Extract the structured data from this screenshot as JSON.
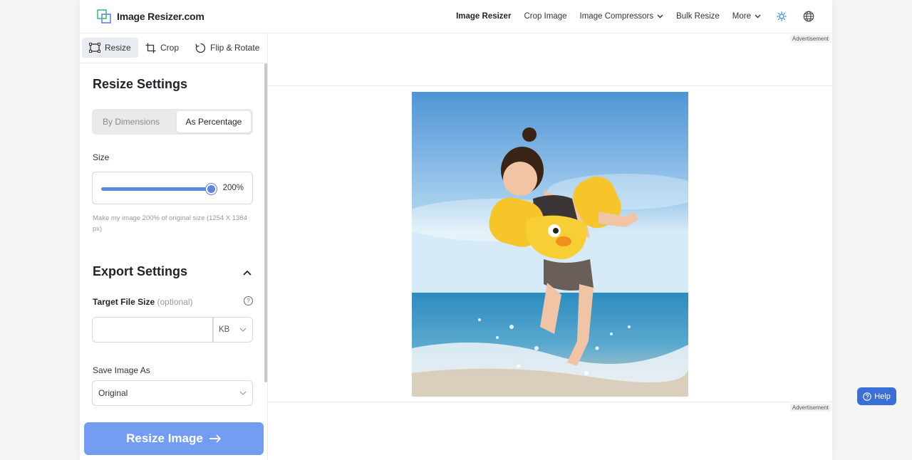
{
  "header": {
    "logo_text": "Image Resizer.com",
    "nav": [
      {
        "label": "Image Resizer"
      },
      {
        "label": "Crop Image"
      },
      {
        "label": "Image Compressors"
      },
      {
        "label": "Bulk Resize"
      },
      {
        "label": "More"
      }
    ]
  },
  "sidebar": {
    "tools": [
      {
        "label": "Resize",
        "icon": "resize-icon"
      },
      {
        "label": "Crop",
        "icon": "crop-icon"
      },
      {
        "label": "Flip & Rotate",
        "icon": "rotate-icon"
      }
    ],
    "resize_settings": {
      "title": "Resize Settings",
      "modes": [
        "By Dimensions",
        "As Percentage"
      ],
      "active_mode": "As Percentage",
      "size_label": "Size",
      "size_percent": 200,
      "size_value_text": "200%",
      "hint": "Make my image 200% of original size (1254 X 1384 px)"
    },
    "export_settings": {
      "title": "Export Settings",
      "target_label": "Target File Size",
      "target_optional": "(optional)",
      "target_value": "",
      "unit": "KB",
      "save_as_label": "Save Image As",
      "save_as_value": "Original"
    },
    "resize_button": "Resize Image"
  },
  "main": {
    "ad_top": "Advertisement",
    "ad_bottom": "Advertisement"
  },
  "help": "Help",
  "colors": {
    "accent": "#5e86dd",
    "button": "#739df1",
    "help": "#3b6fd8"
  }
}
